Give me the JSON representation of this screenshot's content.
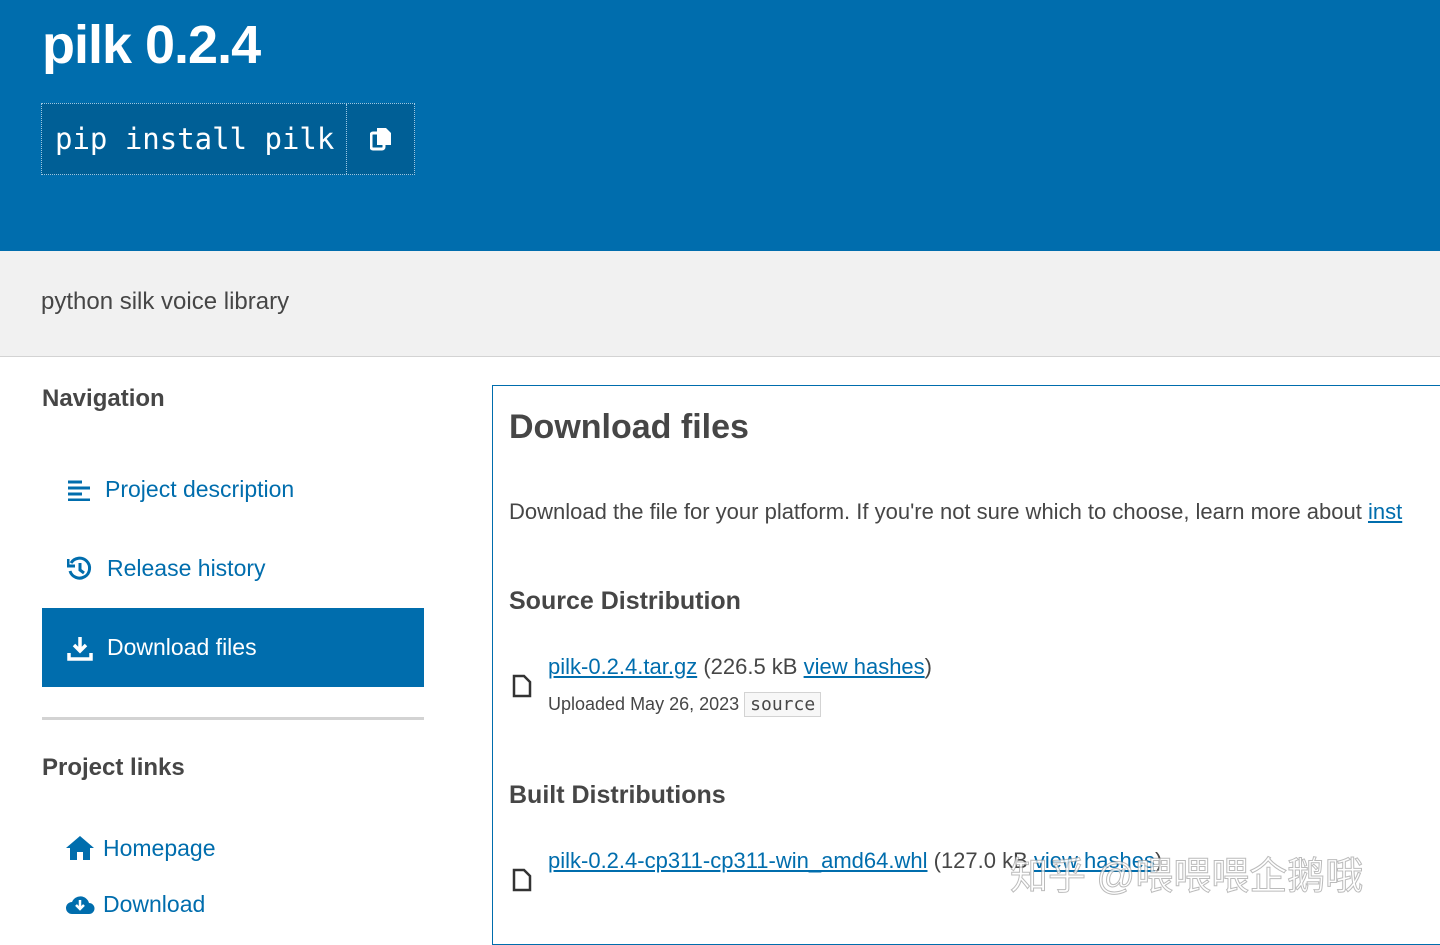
{
  "header": {
    "title": "pilk 0.2.4",
    "pip_command": "pip install pilk",
    "copy_icon": "copy-icon"
  },
  "summary": "python silk voice library",
  "sidebar": {
    "navigation_heading": "Navigation",
    "nav_items": [
      {
        "label": "Project description",
        "icon": "list-icon"
      },
      {
        "label": "Release history",
        "icon": "history-icon"
      },
      {
        "label": "Download files",
        "icon": "download-icon",
        "active": true
      }
    ],
    "project_links_heading": "Project links",
    "links": [
      {
        "label": "Homepage",
        "icon": "home-icon"
      },
      {
        "label": "Download",
        "icon": "cloud-download-icon"
      }
    ]
  },
  "main": {
    "title": "Download files",
    "intro_text": "Download the file for your platform. If you're not sure which to choose, learn more about ",
    "intro_link": "inst",
    "source_heading": "Source Distribution",
    "source_file": {
      "name": "pilk-0.2.4.tar.gz",
      "size": "(226.5 kB ",
      "hashes": "view hashes",
      "close": ")",
      "uploaded": "Uploaded May 26, 2023",
      "badge": "source"
    },
    "built_heading": "Built Distributions",
    "built_file": {
      "name": "pilk-0.2.4-cp311-cp311-win_amd64.whl",
      "size": "(127.0 kB ",
      "hashes": "view hashes",
      "close": ")"
    }
  },
  "watermark": "知乎 @喂喂喂企鹅哦",
  "colors": {
    "brand": "#006dad",
    "band": "#f1f1f1"
  }
}
